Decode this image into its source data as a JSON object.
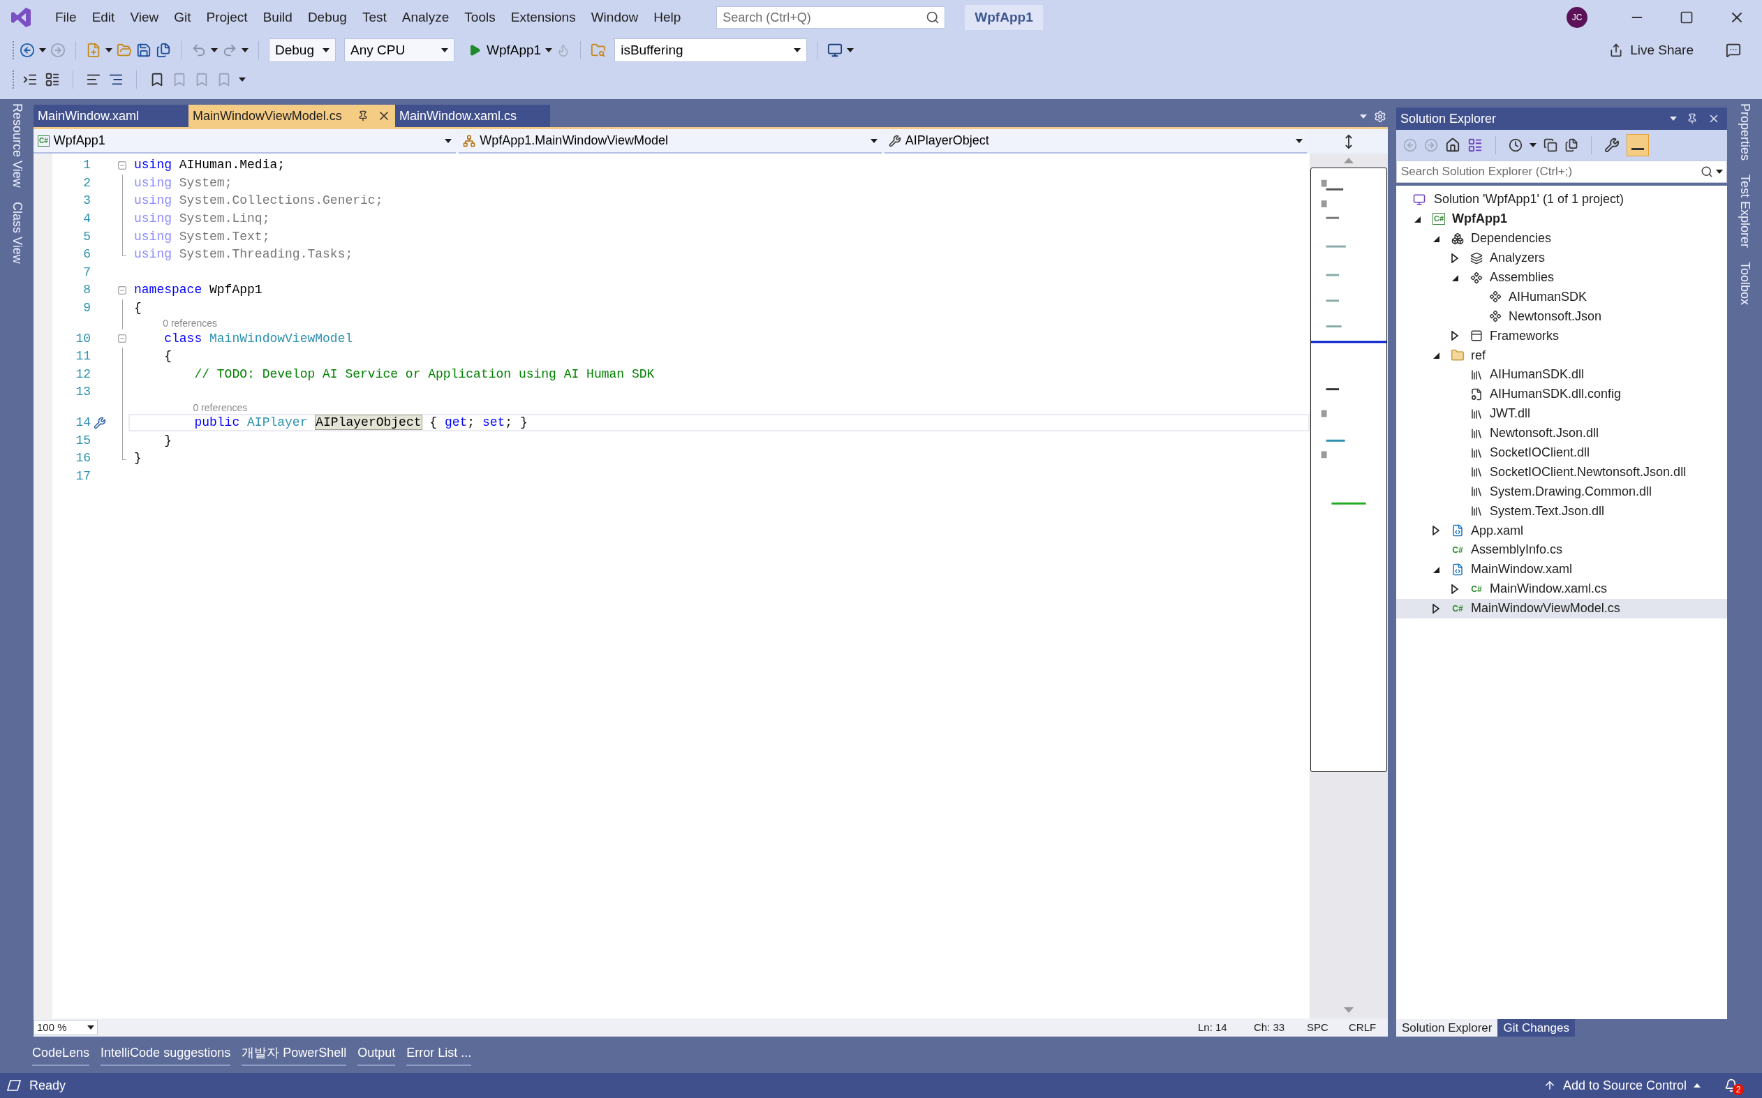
{
  "window": {
    "title_badge": "WpfApp1",
    "avatar": "JC"
  },
  "menu": [
    "File",
    "Edit",
    "View",
    "Git",
    "Project",
    "Build",
    "Debug",
    "Test",
    "Analyze",
    "Tools",
    "Extensions",
    "Window",
    "Help"
  ],
  "search": {
    "placeholder": "Search (Ctrl+Q)"
  },
  "toolbar": {
    "configuration": "Debug",
    "platform": "Any CPU",
    "start": "WpfApp1",
    "find": "isBuffering"
  },
  "live_share": "Live Share",
  "left_tool_tabs": [
    "Resource View",
    "Class View"
  ],
  "right_tool_tabs": [
    "Properties",
    "Test Explorer",
    "Toolbox"
  ],
  "editor_tabs": [
    {
      "label": "MainWindow.xaml",
      "selected": false
    },
    {
      "label": "MainWindowViewModel.cs",
      "selected": true
    },
    {
      "label": "MainWindow.xaml.cs",
      "selected": false
    }
  ],
  "navigation_bar": [
    {
      "kind": "project",
      "icon_label": "C#",
      "label": "WpfApp1"
    },
    {
      "kind": "class",
      "label": "WpfApp1.MainWindowViewModel"
    },
    {
      "kind": "property",
      "label": "AIPlayerObject"
    }
  ],
  "code_lines": [
    {
      "number": "1",
      "kind": "fold_start",
      "current": false,
      "tokens": [
        {
          "kind": "keyword",
          "text": "using"
        },
        {
          "kind": "text",
          "text": " AIHuman.Media;"
        }
      ]
    },
    {
      "number": "2",
      "kind": "fold_body",
      "current": false,
      "tokens": [
        {
          "kind": "keyword_dim",
          "text": "using"
        },
        {
          "kind": "text_dim",
          "text": " System;"
        }
      ]
    },
    {
      "number": "3",
      "kind": "fold_body",
      "current": false,
      "tokens": [
        {
          "kind": "keyword_dim",
          "text": "using"
        },
        {
          "kind": "text_dim",
          "text": " System.Collections.Generic;"
        }
      ]
    },
    {
      "number": "4",
      "kind": "fold_body",
      "current": false,
      "tokens": [
        {
          "kind": "keyword_dim",
          "text": "using"
        },
        {
          "kind": "text_dim",
          "text": " System.Linq;"
        }
      ]
    },
    {
      "number": "5",
      "kind": "fold_body",
      "current": false,
      "tokens": [
        {
          "kind": "keyword_dim",
          "text": "using"
        },
        {
          "kind": "text_dim",
          "text": " System.Text;"
        }
      ]
    },
    {
      "number": "6",
      "kind": "fold_end",
      "current": false,
      "tokens": [
        {
          "kind": "keyword_dim",
          "text": "using"
        },
        {
          "kind": "text_dim",
          "text": " System.Threading.Tasks;"
        }
      ]
    },
    {
      "number": "7",
      "kind": "plain",
      "current": false
    },
    {
      "number": "8",
      "kind": "fold_start",
      "current": false,
      "tokens": [
        {
          "kind": "keyword",
          "text": "namespace"
        },
        {
          "kind": "text",
          "text": " WpfApp1"
        }
      ]
    },
    {
      "number": "9",
      "kind": "fold_body",
      "current": false,
      "tokens": [
        {
          "kind": "text",
          "text": "{"
        }
      ]
    },
    {
      "number": "10",
      "kind": "fold_start",
      "current": false,
      "codelens": "0 references",
      "tokens": [
        {
          "kind": "keyword",
          "text": "    class"
        },
        {
          "kind": "type",
          "text": " MainWindowViewModel"
        }
      ]
    },
    {
      "number": "11",
      "kind": "fold_body",
      "current": false,
      "tokens": [
        {
          "kind": "text",
          "text": "    {"
        }
      ]
    },
    {
      "number": "12",
      "kind": "fold_body",
      "current": false,
      "tokens": [
        {
          "kind": "comment",
          "text": "        // TODO: Develop AI Service or Application using AI Human SDK"
        }
      ]
    },
    {
      "number": "13",
      "kind": "fold_body",
      "current": false
    },
    {
      "number": "14",
      "kind": "fold_body",
      "current": true,
      "codelens": "0 references",
      "tokens": [
        {
          "kind": "keyword",
          "text": "        public"
        },
        {
          "kind": "type",
          "text": " AIPlayer "
        },
        {
          "kind": "ref_highlight",
          "text": "AIPlayerObject"
        },
        {
          "kind": "text",
          "text": " { "
        },
        {
          "kind": "keyword",
          "text": "get"
        },
        {
          "kind": "text",
          "text": "; "
        },
        {
          "kind": "keyword",
          "text": "set"
        },
        {
          "kind": "text",
          "text": "; }"
        }
      ]
    },
    {
      "number": "15",
      "kind": "fold_body",
      "current": false,
      "tokens": [
        {
          "kind": "text",
          "text": "    }"
        }
      ]
    },
    {
      "number": "16",
      "kind": "fold_end",
      "current": false,
      "tokens": [
        {
          "kind": "text",
          "text": "}"
        }
      ]
    },
    {
      "number": "17",
      "kind": "plain",
      "current": false
    }
  ],
  "editor_status": {
    "zoom": "100 %",
    "line": "Ln: 14",
    "column": "Ch: 33",
    "whitespace": "SPC",
    "line_endings": "CRLF"
  },
  "solution_explorer": {
    "title": "Solution Explorer",
    "search": {
      "placeholder": "Search Solution Explorer (Ctrl+;)"
    },
    "solution": {
      "label": "Solution 'WpfApp1' (1 of 1 project)",
      "children": [
        {
          "label": "WpfApp1",
          "kind": "project",
          "icon_label": "C#",
          "expandable": true,
          "expanded": true,
          "selected": false,
          "children": [
            {
              "label": "Dependencies",
              "kind": "dependencies",
              "expandable": true,
              "expanded": true,
              "selected": false,
              "children": [
                {
                  "label": "Analyzers",
                  "kind": "analyzers",
                  "expandable": true,
                  "expanded": false,
                  "selected": false
                },
                {
                  "label": "Assemblies",
                  "kind": "assemblies",
                  "expandable": true,
                  "expanded": true,
                  "selected": false,
                  "children": [
                    {
                      "label": "AIHumanSDK",
                      "kind": "assembly",
                      "expandable": false,
                      "expanded": false,
                      "selected": false
                    },
                    {
                      "label": "Newtonsoft.Json",
                      "kind": "assembly",
                      "expandable": false,
                      "expanded": false,
                      "selected": false
                    }
                  ]
                },
                {
                  "label": "Frameworks",
                  "kind": "frameworks",
                  "expandable": true,
                  "expanded": false,
                  "selected": false
                }
              ]
            },
            {
              "label": "ref",
              "kind": "folder",
              "expandable": true,
              "expanded": true,
              "selected": false,
              "children": [
                {
                  "label": "AIHumanSDK.dll",
                  "kind": "dll",
                  "expandable": false,
                  "expanded": false,
                  "selected": false
                },
                {
                  "label": "AIHumanSDK.dll.config",
                  "kind": "config",
                  "expandable": false,
                  "expanded": false,
                  "selected": false
                },
                {
                  "label": "JWT.dll",
                  "kind": "dll",
                  "expandable": false,
                  "expanded": false,
                  "selected": false
                },
                {
                  "label": "Newtonsoft.Json.dll",
                  "kind": "dll",
                  "expandable": false,
                  "expanded": false,
                  "selected": false
                },
                {
                  "label": "SocketIOClient.dll",
                  "kind": "dll",
                  "expandable": false,
                  "expanded": false,
                  "selected": false
                },
                {
                  "label": "SocketIOClient.Newtonsoft.Json.dll",
                  "kind": "dll",
                  "expandable": false,
                  "expanded": false,
                  "selected": false
                },
                {
                  "label": "System.Drawing.Common.dll",
                  "kind": "dll",
                  "expandable": false,
                  "expanded": false,
                  "selected": false
                },
                {
                  "label": "System.Text.Json.dll",
                  "kind": "dll",
                  "expandable": false,
                  "expanded": false,
                  "selected": false
                }
              ]
            },
            {
              "label": "App.xaml",
              "kind": "xaml",
              "expandable": true,
              "expanded": false,
              "selected": false
            },
            {
              "label": "AssemblyInfo.cs",
              "kind": "cs",
              "icon_label": "C#",
              "expandable": false,
              "expanded": false,
              "selected": false
            },
            {
              "label": "MainWindow.xaml",
              "kind": "xaml",
              "expandable": true,
              "expanded": true,
              "selected": false,
              "children": [
                {
                  "label": "MainWindow.xaml.cs",
                  "kind": "cs",
                  "icon_label": "C#",
                  "expandable": true,
                  "expanded": false,
                  "selected": false
                }
              ]
            },
            {
              "label": "MainWindowViewModel.cs",
              "kind": "cs",
              "icon_label": "C#",
              "expandable": true,
              "expanded": false,
              "selected": true
            }
          ]
        }
      ]
    },
    "tabs": [
      {
        "label": "Solution Explorer",
        "selected": true
      },
      {
        "label": "Git Changes",
        "selected": false
      }
    ]
  },
  "bottom_tabs": [
    "CodeLens",
    "IntelliCode suggestions",
    "개발자 PowerShell",
    "Output",
    "Error List ..."
  ],
  "status_bar": {
    "text": "Ready",
    "source_control": "Add to Source Control",
    "notifications": "2"
  }
}
